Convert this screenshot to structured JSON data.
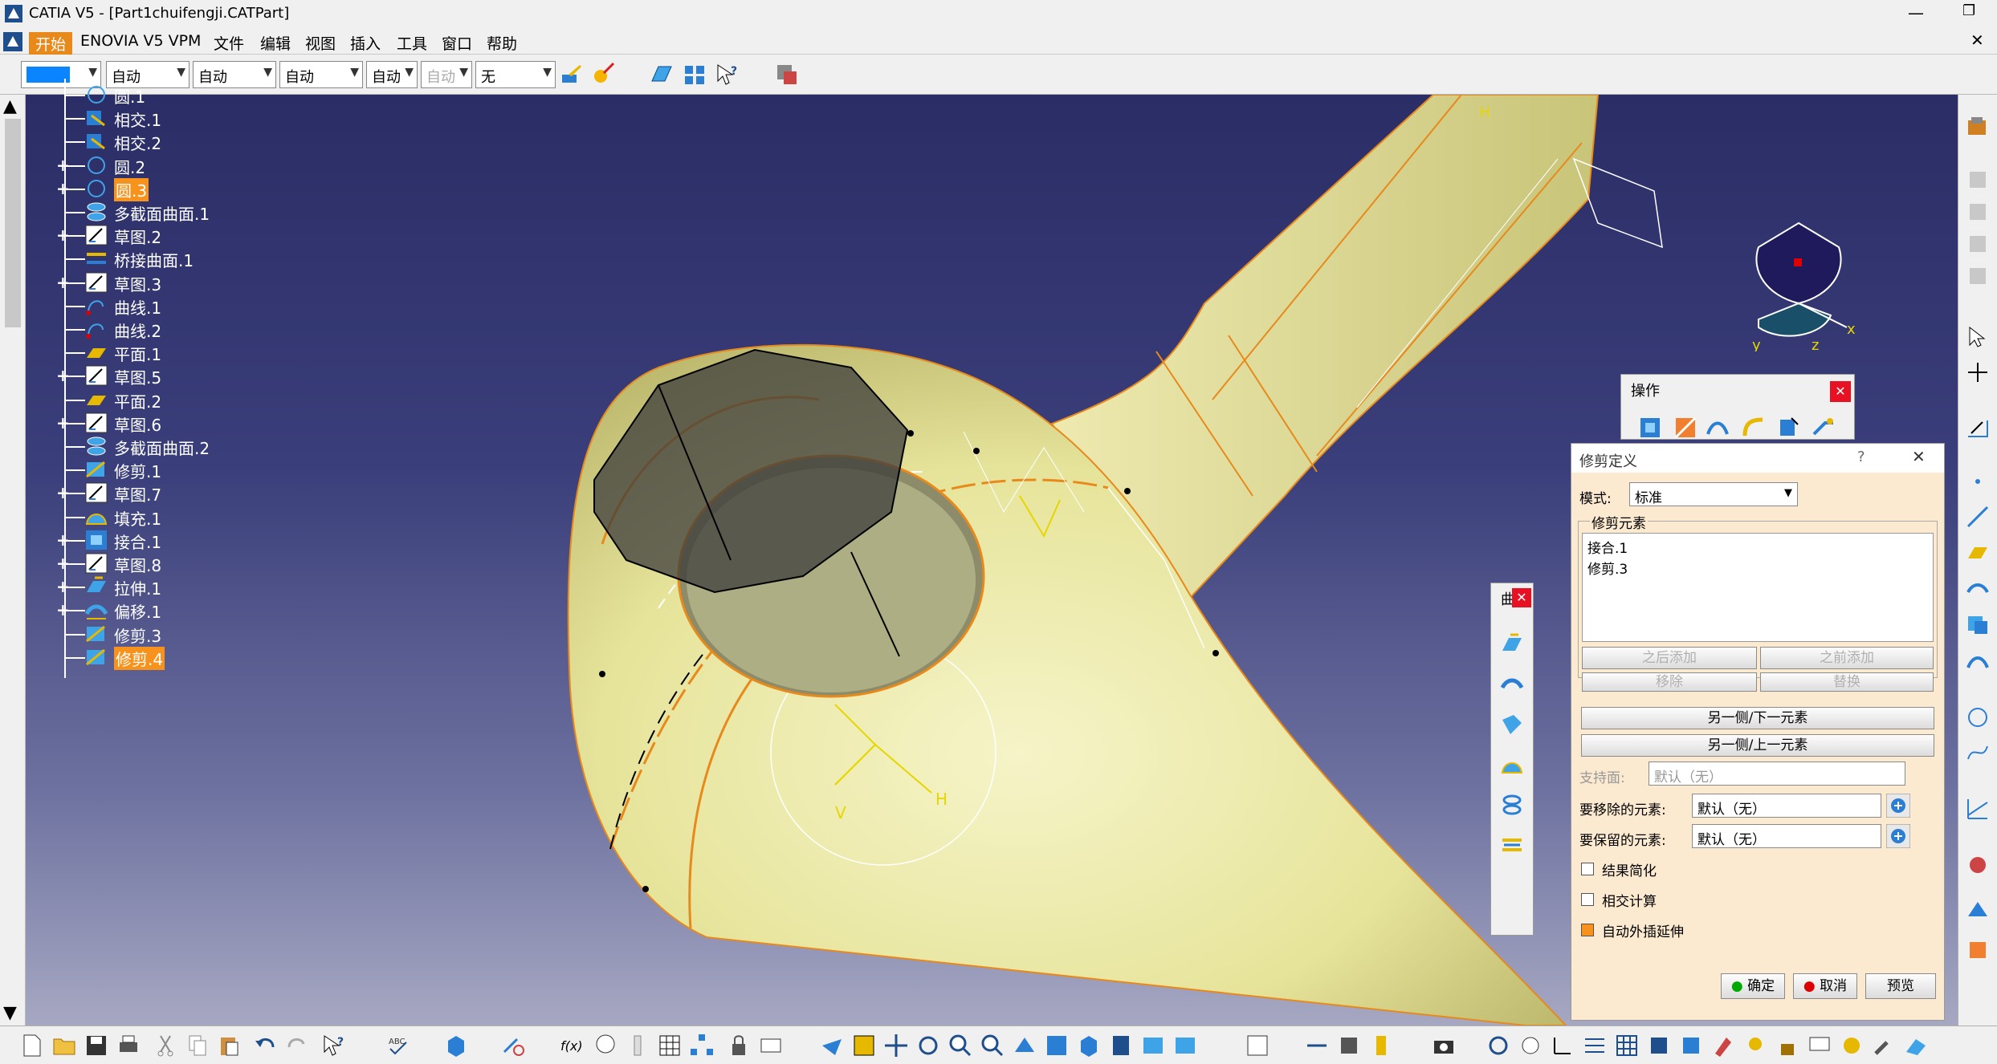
{
  "app": {
    "title": "CATIA V5 - [Part1chuifengji.CATPart]"
  },
  "menu": [
    "开始",
    "ENOVIA V5 VPM",
    "文件",
    "编辑",
    "视图",
    "插入",
    "工具",
    "窗口",
    "帮助"
  ],
  "toolbar": {
    "color": "#0a84ff",
    "combos": [
      "自动",
      "自动",
      "自动",
      "自动",
      "自动",
      "无"
    ]
  },
  "tree": [
    {
      "label": "圆.1",
      "icon": "circle-icon",
      "expandable": false,
      "selected": false
    },
    {
      "label": "相交.1",
      "icon": "intersect-icon",
      "expandable": false,
      "selected": false
    },
    {
      "label": "相交.2",
      "icon": "intersect-icon",
      "expandable": false,
      "selected": false
    },
    {
      "label": "圆.2",
      "icon": "circle-icon",
      "expandable": true,
      "selected": false
    },
    {
      "label": "圆.3",
      "icon": "circle-icon",
      "expandable": true,
      "selected": true
    },
    {
      "label": "多截面曲面.1",
      "icon": "multisection-surface-icon",
      "expandable": false,
      "selected": false
    },
    {
      "label": "草图.2",
      "icon": "sketch-icon",
      "expandable": true,
      "selected": false
    },
    {
      "label": "桥接曲面.1",
      "icon": "blend-surface-icon",
      "expandable": false,
      "selected": false
    },
    {
      "label": "草图.3",
      "icon": "sketch-icon",
      "expandable": true,
      "selected": false
    },
    {
      "label": "曲线.1",
      "icon": "curve-icon",
      "expandable": false,
      "selected": false
    },
    {
      "label": "曲线.2",
      "icon": "curve-icon",
      "expandable": false,
      "selected": false
    },
    {
      "label": "平面.1",
      "icon": "plane-icon",
      "expandable": false,
      "selected": false
    },
    {
      "label": "草图.5",
      "icon": "sketch-icon",
      "expandable": true,
      "selected": false
    },
    {
      "label": "平面.2",
      "icon": "plane-icon",
      "expandable": false,
      "selected": false
    },
    {
      "label": "草图.6",
      "icon": "sketch-icon",
      "expandable": true,
      "selected": false
    },
    {
      "label": "多截面曲面.2",
      "icon": "multisection-surface-icon",
      "expandable": false,
      "selected": false
    },
    {
      "label": "修剪.1",
      "icon": "trim-icon",
      "expandable": false,
      "selected": false
    },
    {
      "label": "草图.7",
      "icon": "sketch-icon",
      "expandable": true,
      "selected": false
    },
    {
      "label": "填充.1",
      "icon": "fill-icon",
      "expandable": false,
      "selected": false
    },
    {
      "label": "接合.1",
      "icon": "join-icon",
      "expandable": true,
      "selected": false
    },
    {
      "label": "草图.8",
      "icon": "sketch-icon",
      "expandable": true,
      "selected": false
    },
    {
      "label": "拉伸.1",
      "icon": "extrude-icon",
      "expandable": true,
      "selected": false
    },
    {
      "label": "偏移.1",
      "icon": "offset-icon",
      "expandable": true,
      "selected": false
    },
    {
      "label": "修剪.3",
      "icon": "trim-icon",
      "expandable": false,
      "selected": false
    },
    {
      "label": "修剪.4",
      "icon": "trim-icon",
      "expandable": false,
      "selected": true
    }
  ],
  "ops_panel": {
    "title": "操作"
  },
  "curve_panel": {
    "title": "曲"
  },
  "trim_dialog": {
    "title": "修剪定义",
    "help": "?",
    "mode_label": "模式:",
    "mode_value": "标准",
    "elements_label": "修剪元素",
    "elements": [
      "接合.1",
      "修剪.3"
    ],
    "btn_add_after": "之后添加",
    "btn_add_before": "之前添加",
    "btn_remove": "移除",
    "btn_replace": "替换",
    "btn_other_side_next": "另一侧/下一元素",
    "btn_other_side_prev": "另一侧/上一元素",
    "support_label": "支持面:",
    "support_value": "默认（无）",
    "remove_label": "要移除的元素:",
    "remove_value": "默认（无）",
    "keep_label": "要保留的元素:",
    "keep_value": "默认（无）",
    "chk_simplify": "结果简化",
    "chk_intersect": "相交计算",
    "chk_extrapolate": "自动外插延伸",
    "chk_simplify_checked": false,
    "chk_intersect_checked": false,
    "chk_extrapolate_checked": true,
    "ok": "确定",
    "cancel": "取消",
    "preview": "预览"
  },
  "compass": {
    "x_label": "x",
    "y_label": "y",
    "z_label": "z"
  },
  "viewport_marks": {
    "h1": "H",
    "h2": "H",
    "v1": "V"
  }
}
